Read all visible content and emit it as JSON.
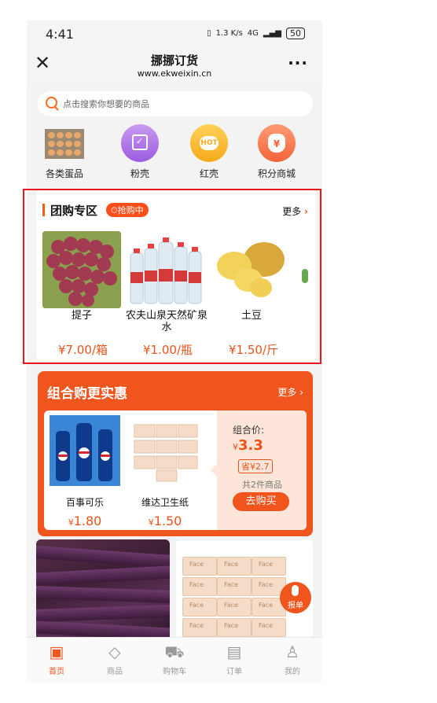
{
  "status": {
    "time": "4:41",
    "net_speed": "1.3 K/s",
    "signal": "4G",
    "battery": "50"
  },
  "nav": {
    "title": "挪挪订货",
    "url": "www.ekweixin.cn"
  },
  "search": {
    "placeholder": "点击搜索你想要的商品"
  },
  "categories": [
    {
      "label": "各类蛋品",
      "icon": "egg-tray-icon"
    },
    {
      "label": "粉壳",
      "icon": "calendar-check-icon"
    },
    {
      "label": "红壳",
      "icon": "hot-icon"
    },
    {
      "label": "积分商城",
      "icon": "money-bag-icon"
    }
  ],
  "group_buy": {
    "title": "团购专区",
    "badge": "抢购中",
    "more": "更多",
    "products": [
      {
        "name": "提子",
        "price": "¥7.00/箱"
      },
      {
        "name": "农夫山泉天然矿泉水",
        "price": "¥1.00/瓶"
      },
      {
        "name": "土豆",
        "price": "¥1.50/斤"
      }
    ]
  },
  "combo": {
    "title": "组合购更实惠",
    "more": "更多",
    "products": [
      {
        "name": "百事可乐",
        "currency": "¥",
        "price": "1.80"
      },
      {
        "name": "维达卫生纸",
        "currency": "¥",
        "price": "1.50"
      }
    ],
    "combo_label": "组合价:",
    "combo_currency": "¥",
    "combo_price": "3.3",
    "save": "省¥2.7",
    "count": "共2件商品",
    "buy": "去购买"
  },
  "float_button": {
    "label": "报单"
  },
  "tabs": [
    {
      "label": "首页",
      "icon": "home-icon",
      "active": true
    },
    {
      "label": "商品",
      "icon": "goods-icon",
      "active": false
    },
    {
      "label": "购物车",
      "icon": "cart-icon",
      "active": false
    },
    {
      "label": "订单",
      "icon": "order-icon",
      "active": false
    },
    {
      "label": "我的",
      "icon": "profile-icon",
      "active": false
    }
  ],
  "colors": {
    "accent": "#f0551d",
    "price": "#e8531a",
    "highlight_frame": "#e8171e"
  }
}
